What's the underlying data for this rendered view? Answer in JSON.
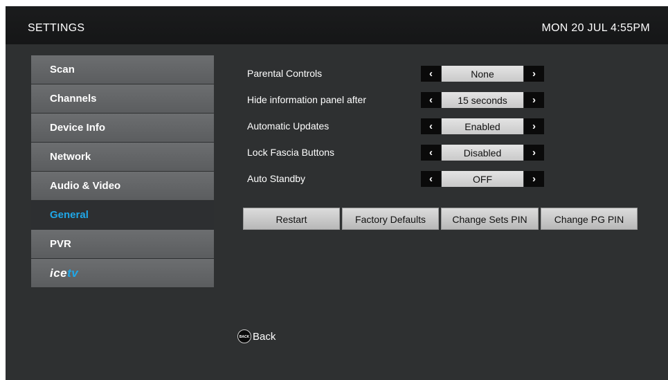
{
  "header": {
    "title": "SETTINGS",
    "datetime": "MON 20 JUL 4:55PM"
  },
  "sidebar": {
    "items": [
      {
        "label": "Scan"
      },
      {
        "label": "Channels"
      },
      {
        "label": "Device Info"
      },
      {
        "label": "Network"
      },
      {
        "label": "Audio & Video"
      },
      {
        "label": "General",
        "selected": true
      },
      {
        "label": "PVR"
      }
    ],
    "logo": {
      "part1": "ice",
      "part2": "tv"
    }
  },
  "settings": [
    {
      "label": "Parental Controls",
      "value": "None"
    },
    {
      "label": "Hide information panel after",
      "value": "15 seconds"
    },
    {
      "label": "Automatic Updates",
      "value": "Enabled"
    },
    {
      "label": "Lock Fascia Buttons",
      "value": "Disabled"
    },
    {
      "label": "Auto Standby",
      "value": "OFF"
    }
  ],
  "arrows": {
    "left": "‹",
    "right": "›"
  },
  "actions": {
    "restart": "Restart",
    "factory_defaults": "Factory Defaults",
    "change_sets_pin": "Change Sets PIN",
    "change_pg_pin": "Change PG PIN"
  },
  "footer": {
    "back_icon_text": "BACK",
    "back_label": "Back"
  },
  "colors": {
    "accent": "#1fa7e8",
    "background": "#2e3031",
    "header": "#1b1c1d"
  }
}
